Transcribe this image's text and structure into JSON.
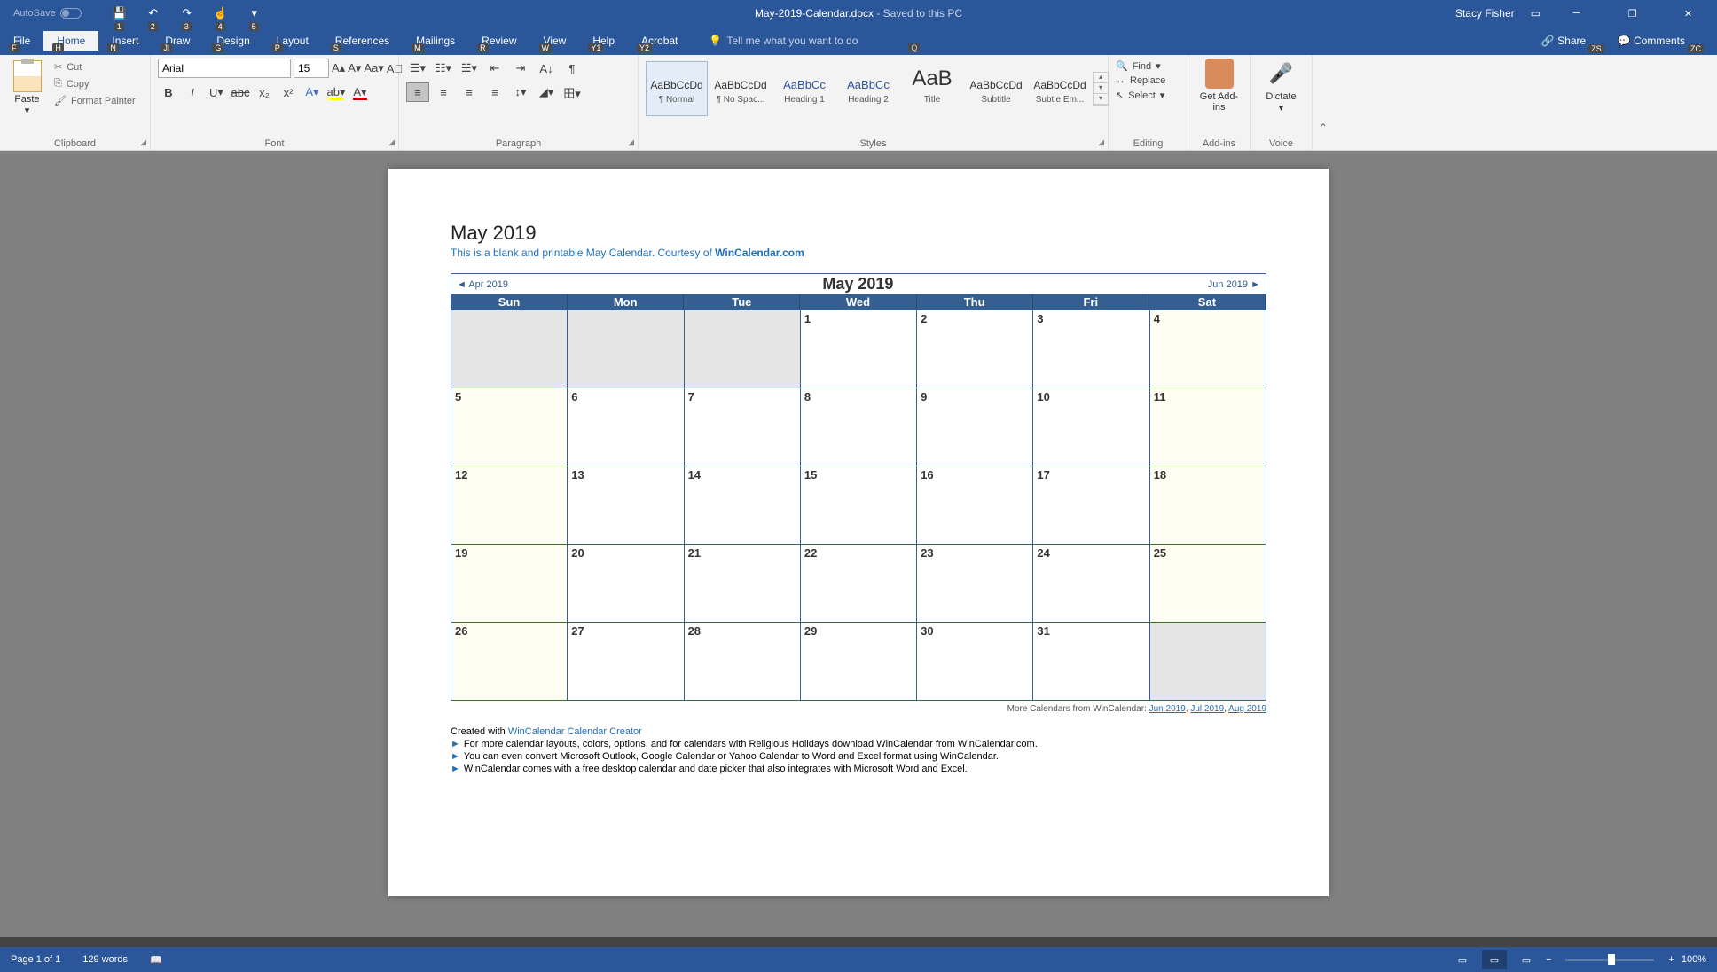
{
  "titlebar": {
    "autosave": "AutoSave",
    "filename": "May-2019-Calendar.docx",
    "saved": " - Saved to this PC",
    "user": "Stacy Fisher"
  },
  "qat": [
    "1",
    "2",
    "3",
    "4",
    "5"
  ],
  "tabs": {
    "file": "File",
    "file_k": "F",
    "home": "Home",
    "home_k": "H",
    "insert": "Insert",
    "insert_k": "N",
    "draw": "Draw",
    "draw_k": "JI",
    "design": "Design",
    "design_k": "G",
    "layout": "Layout",
    "layout_k": "P",
    "references": "References",
    "references_k": "S",
    "mailings": "Mailings",
    "mailings_k": "M",
    "review": "Review",
    "review_k": "R",
    "view": "View",
    "view_k": "W",
    "help": "Help",
    "help_k": "Y1",
    "acrobat": "Acrobat",
    "acrobat_k": "Y2",
    "tell": "Tell me what you want to do",
    "tell_k": "Q",
    "share": "Share",
    "share_k": "ZS",
    "comments": "Comments",
    "comments_k": "ZC"
  },
  "clipboard": {
    "label": "Clipboard",
    "paste": "Paste",
    "cut": "Cut",
    "copy": "Copy",
    "fmt": "Format Painter"
  },
  "font": {
    "label": "Font",
    "name": "Arial",
    "size": "15"
  },
  "paragraph": {
    "label": "Paragraph"
  },
  "styles": {
    "label": "Styles",
    "items": [
      {
        "preview": "AaBbCcDd",
        "name": "¶ Normal"
      },
      {
        "preview": "AaBbCcDd",
        "name": "¶ No Spac..."
      },
      {
        "preview": "AaBbCc",
        "name": "Heading 1"
      },
      {
        "preview": "AaBbCc",
        "name": "Heading 2"
      },
      {
        "preview": "AaB",
        "name": "Title"
      },
      {
        "preview": "AaBbCcDd",
        "name": "Subtitle"
      },
      {
        "preview": "AaBbCcDd",
        "name": "Subtle Em..."
      }
    ]
  },
  "editing": {
    "label": "Editing",
    "find": "Find",
    "replace": "Replace",
    "select": "Select"
  },
  "addins": {
    "label": "Add-ins",
    "get": "Get Add-ins"
  },
  "voice": {
    "label": "Voice",
    "dictate": "Dictate"
  },
  "doc": {
    "title": "May 2019",
    "sub1": "This is a blank and printable May Calendar.  Courtesy of ",
    "sub_link": "WinCalendar.com",
    "prev": "◄ Apr 2019",
    "center": "May   2019",
    "next": "Jun 2019 ►",
    "days": [
      "Sun",
      "Mon",
      "Tue",
      "Wed",
      "Thu",
      "Fri",
      "Sat"
    ],
    "weeks": [
      [
        {
          "n": "",
          "c": "gray"
        },
        {
          "n": "",
          "c": "gray"
        },
        {
          "n": "",
          "c": "gray"
        },
        {
          "n": "1",
          "c": ""
        },
        {
          "n": "2",
          "c": ""
        },
        {
          "n": "3",
          "c": ""
        },
        {
          "n": "4",
          "c": "wknd"
        }
      ],
      [
        {
          "n": "5",
          "c": "wknd"
        },
        {
          "n": "6",
          "c": ""
        },
        {
          "n": "7",
          "c": ""
        },
        {
          "n": "8",
          "c": ""
        },
        {
          "n": "9",
          "c": ""
        },
        {
          "n": "10",
          "c": ""
        },
        {
          "n": "11",
          "c": "wknd"
        }
      ],
      [
        {
          "n": "12",
          "c": "wknd"
        },
        {
          "n": "13",
          "c": ""
        },
        {
          "n": "14",
          "c": ""
        },
        {
          "n": "15",
          "c": ""
        },
        {
          "n": "16",
          "c": ""
        },
        {
          "n": "17",
          "c": ""
        },
        {
          "n": "18",
          "c": "wknd"
        }
      ],
      [
        {
          "n": "19",
          "c": "wknd"
        },
        {
          "n": "20",
          "c": ""
        },
        {
          "n": "21",
          "c": ""
        },
        {
          "n": "22",
          "c": ""
        },
        {
          "n": "23",
          "c": ""
        },
        {
          "n": "24",
          "c": ""
        },
        {
          "n": "25",
          "c": "wknd"
        }
      ],
      [
        {
          "n": "26",
          "c": "wknd"
        },
        {
          "n": "27",
          "c": ""
        },
        {
          "n": "28",
          "c": ""
        },
        {
          "n": "29",
          "c": ""
        },
        {
          "n": "30",
          "c": ""
        },
        {
          "n": "31",
          "c": ""
        },
        {
          "n": "",
          "c": "gray"
        }
      ]
    ],
    "more": "More Calendars from WinCalendar: ",
    "more_links": [
      "Jun 2019",
      "Jul 2019",
      "Aug 2019"
    ],
    "created": "Created with ",
    "created_link": "WinCalendar Calendar Creator",
    "bullets": [
      "For more calendar layouts, colors, options, and for calendars with Religious Holidays download WinCalendar from WinCalendar.com.",
      "You can even convert Microsoft Outlook, Google Calendar or Yahoo Calendar to Word and Excel format using WinCalendar.",
      "WinCalendar comes with a free desktop calendar and date picker that also integrates with Microsoft Word and Excel."
    ]
  },
  "status": {
    "page": "Page 1 of 1",
    "words": "129 words",
    "zoom": "100%"
  }
}
